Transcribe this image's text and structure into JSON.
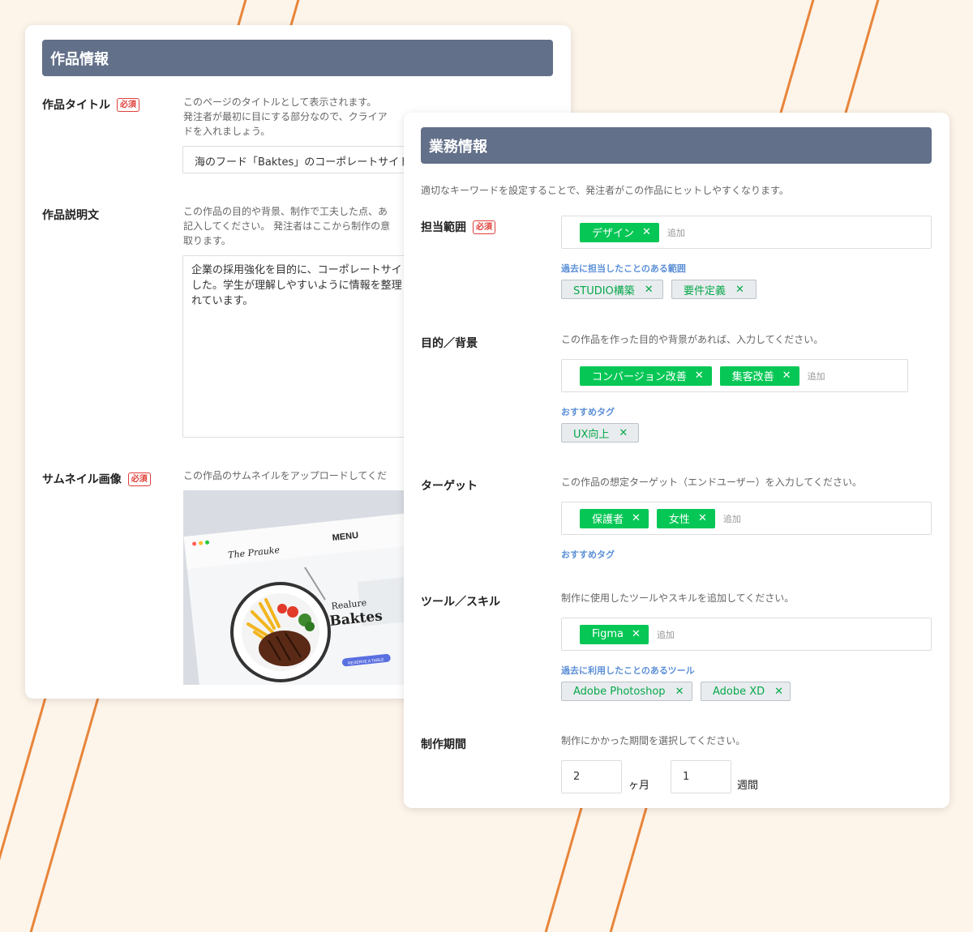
{
  "colors": {
    "accent_green": "#06c755",
    "header_bg": "#627089",
    "stripe": "#e8853a",
    "required": "#e0403a",
    "sub_link": "#5b8fd6"
  },
  "left": {
    "title": "作品情報",
    "required": "必須",
    "work_title": {
      "label": "作品タイトル",
      "help": [
        "このページのタイトルとして表示されます。",
        "発注者が最初に目にする部分なので、クライア",
        "ドを入れましょう。"
      ],
      "value": "海のフード「Baktes」のコーポレートサイト"
    },
    "description": {
      "label": "作品説明文",
      "help": [
        "この作品の目的や背景、制作で工夫した点、あ",
        "記入してください。 発注者はここから制作の意",
        "取ります。"
      ],
      "value": [
        "企業の採用強化を目的に、コーポレートサイ",
        "した。学生が理解しやすいように情報を整理",
        "れています。"
      ]
    },
    "thumbnail": {
      "label": "サムネイル画像",
      "help": "この作品のサムネイルをアップロードしてくだ",
      "menu": "MENU",
      "logo": "The Prauke",
      "heading1": "Realure",
      "heading2": "Baktes",
      "button": "RESERVE A TABLE"
    }
  },
  "right": {
    "title": "業務情報",
    "intro": "適切なキーワードを設定することで、発注者がこの作品にヒットしやすくなります。",
    "add_placeholder": "追加",
    "scope": {
      "label": "担当範囲",
      "required": "必須",
      "tags": [
        "デザイン"
      ],
      "sub_label": "過去に担当したことのある範囲",
      "suggestions": [
        "STUDIO構築",
        "要件定義"
      ]
    },
    "purpose": {
      "label": "目的／背景",
      "help": "この作品を作った目的や背景があれば、入力してください。",
      "tags": [
        "コンバージョン改善",
        "集客改善"
      ],
      "sub_label": "おすすめタグ",
      "suggestions": [
        "UX向上"
      ]
    },
    "target": {
      "label": "ターゲット",
      "help": "この作品の想定ターゲット（エンドユーザー）を入力してください。",
      "tags": [
        "保護者",
        "女性"
      ],
      "sub_label": "おすすめタグ"
    },
    "tools": {
      "label": "ツール／スキル",
      "help": "制作に使用したツールやスキルを追加してください。",
      "tags": [
        "Figma"
      ],
      "sub_label": "過去に利用したことのあるツール",
      "suggestions": [
        "Adobe Photoshop",
        "Adobe XD"
      ]
    },
    "period": {
      "label": "制作期間",
      "help": "制作にかかった期間を選択してください。",
      "months": "2",
      "months_unit": "ヶ月",
      "weeks": "1",
      "weeks_unit": "週間"
    },
    "remove_symbol": "✕"
  }
}
